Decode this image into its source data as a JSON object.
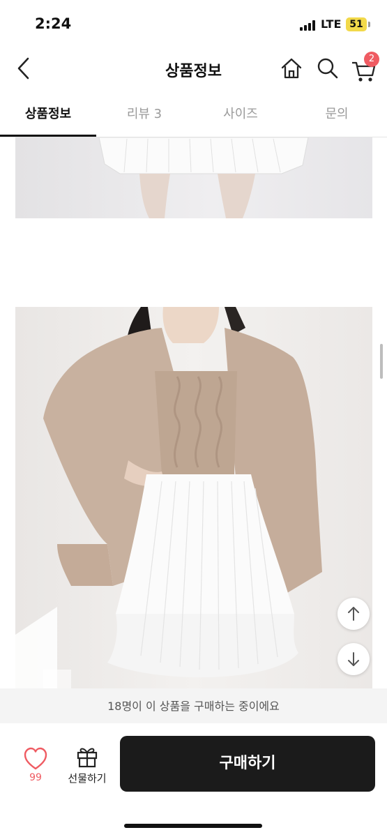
{
  "status_bar": {
    "time": "2:24",
    "network": "LTE",
    "battery": "51"
  },
  "header": {
    "title": "상품정보",
    "cart_badge": "2"
  },
  "tabs": [
    {
      "label": "상품정보",
      "active": true
    },
    {
      "label": "리뷰 3",
      "active": false
    },
    {
      "label": "사이즈",
      "active": false
    },
    {
      "label": "문의",
      "active": false
    }
  ],
  "footer": {
    "buyers_text": "18명이 이 상품을 구매하는 중이에요",
    "like_count": "99",
    "gift_label": "선물하기",
    "buy_label": "구매하기"
  },
  "colors": {
    "accent": "#ef5b62",
    "buy_button": "#1b1b1b"
  },
  "icons": [
    "back-icon",
    "home-icon",
    "search-icon",
    "cart-icon",
    "heart-icon",
    "gift-icon",
    "arrow-up-icon",
    "arrow-down-icon"
  ]
}
